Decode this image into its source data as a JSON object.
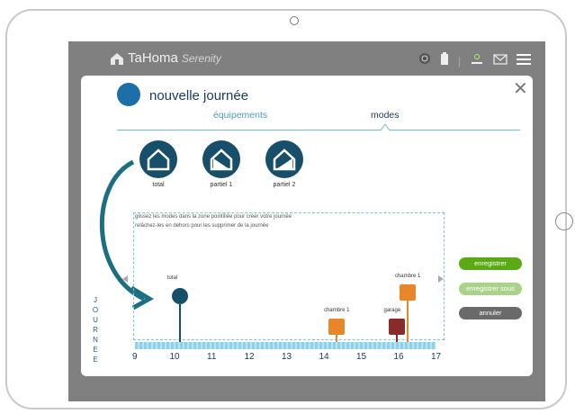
{
  "app": {
    "brand": "TaHoma",
    "brand_suffix": "Serenity"
  },
  "modal": {
    "title": "nouvelle journée",
    "tabs": [
      {
        "label": "équipements"
      },
      {
        "label": "modes"
      }
    ],
    "modes": [
      {
        "label": "total"
      },
      {
        "label": "partiel 1"
      },
      {
        "label": "partiel 2"
      }
    ],
    "hints": [
      "glissez les modes dans la zone pointillée pour créer votre journée",
      "relâchez-les en dehors pour les supprimer de la journée"
    ],
    "vertical_label": "JOURNEE",
    "timeline_ticks": [
      "9",
      "10",
      "11",
      "12",
      "13",
      "14",
      "15",
      "16",
      "17"
    ],
    "markers": [
      {
        "label": "total",
        "hour": 10.2
      },
      {
        "label": "chambre 1",
        "hour": 14.4
      },
      {
        "label": "garage",
        "hour": 16.0
      },
      {
        "label": "chambre 1",
        "hour": 16.3
      }
    ],
    "buttons": {
      "save": "enregistrer",
      "save_as": "enregistrer sous",
      "cancel": "annuler"
    }
  },
  "colors": {
    "primary": "#174f6a",
    "accent": "#5aaa14",
    "orange": "#e8862a",
    "maroon": "#8a2b2b"
  }
}
